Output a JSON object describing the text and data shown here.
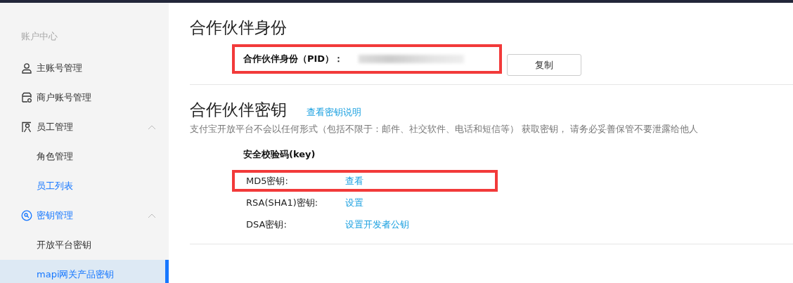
{
  "sidebar": {
    "heading": "账户中心",
    "items": [
      {
        "label": "主账号管理",
        "kind": "item",
        "current": false,
        "selected": false
      },
      {
        "label": "商户账号管理",
        "kind": "item",
        "current": false,
        "selected": false
      },
      {
        "label": "员工管理",
        "kind": "item",
        "current": false,
        "selected": false,
        "expanded": true
      },
      {
        "label": "角色管理",
        "kind": "subitem",
        "current": false,
        "selected": false
      },
      {
        "label": "员工列表",
        "kind": "subitem",
        "current": true,
        "selected": false
      },
      {
        "label": "密钥管理",
        "kind": "item",
        "current": true,
        "selected": false,
        "expanded": true
      },
      {
        "label": "开放平台密钥",
        "kind": "subitem",
        "current": false,
        "selected": false
      },
      {
        "label": "mapi网关产品密钥",
        "kind": "subitem",
        "current": true,
        "selected": true
      }
    ]
  },
  "partner_id": {
    "title": "合作伙伴身份",
    "label": "合作伙伴身份（PID）：",
    "copy_button": "复制"
  },
  "partner_key": {
    "title": "合作伙伴密钥",
    "help_link": "查看密钥说明",
    "notice": "支付宝开放平台不会以任何形式（包括不限于：邮件、社交软件、电话和短信等） 获取密钥， 请务必妥善保管不要泄露给他人",
    "key_heading": "安全校验码(key)",
    "rows": [
      {
        "label": "MD5密钥:",
        "action": "查看",
        "highlighted": true
      },
      {
        "label": "RSA(SHA1)密钥:",
        "action": "设置",
        "highlighted": false
      },
      {
        "label": "DSA密钥:",
        "action": "设置开发者公钥",
        "highlighted": false
      }
    ]
  }
}
